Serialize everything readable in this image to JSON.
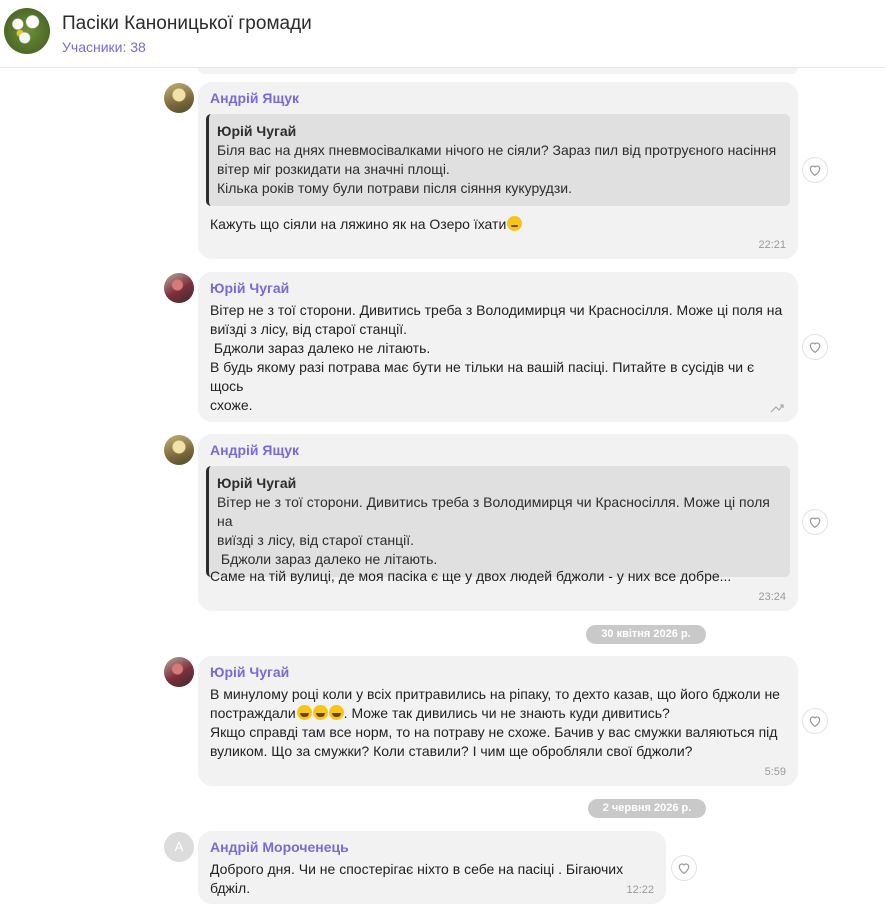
{
  "header": {
    "title": "Пасіки Каноницької громади",
    "members": "Учасники: 38"
  },
  "messages": [
    {
      "sender": "Андрій Ящук",
      "avatar": "andrii-yashchuk-avatar",
      "quote": {
        "author": "Юрій Чугай",
        "lines": [
          "Біля вас на днях пневмосівалками нічого не сіяли? Зараз пил від протруєного насіння",
          "вітер міг розкидати на значні площі.",
          "Кілька років тому були потрави після сіяння кукурудзи."
        ]
      },
      "text_lines": [
        "Кажуть що сіяли на ляжино як на Озеро їхати"
      ],
      "time": "22:21"
    },
    {
      "sender": "Юрій Чугай",
      "avatar": "yurii-chuhai-avatar",
      "text_lines": [
        "Вітер не з тої сторони. Дивитись треба з Володимирця чи Красносілля. Може ці поля на",
        "виїзді з лісу, від старої станції.",
        " Бджоли зараз далеко не літають.",
        "В будь якому разі потрава має бути не тільки на вашій пасіці. Питайте в сусідів чи є щось",
        "схоже."
      ]
    },
    {
      "sender": "Андрій Ящук",
      "avatar": "andrii-yashchuk-avatar",
      "quote": {
        "author": "Юрій Чугай",
        "lines": [
          "Вітер не з тої сторони. Дивитись треба з Володимирця чи Красносілля. Може ці поля на",
          "виїзді з лісу, від старої станції.",
          " Бджоли зараз далеко не літають."
        ]
      },
      "text_lines": [
        "Саме на тій вулиці, де моя пасіка є ще у двох людей бджоли - у них все добре..."
      ],
      "time": "23:24"
    },
    {
      "sender": "Юрій Чугай",
      "avatar": "yurii-chuhai-avatar",
      "text_lines": [
        "В минулому році коли у всіх притравились на ріпаку, то дехто казав, що його бджоли не",
        "постраждали",
        ". Може так дивились чи не знають куди дивитись?",
        "Якщо справді там все норм, то на потраву не схоже. Бачив у вас смужки валяються під",
        "вуликом.  Що за смужки? Коли ставили? І чим ще обробляли свої бджоли?"
      ],
      "time": "5:59"
    },
    {
      "sender": "Андрій Мороченець",
      "avatar_letter": "A",
      "text_lines": [
        "Доброго дня. Чи не спостерігає ніхто в себе на пасіці . Бігаючих бджіл."
      ],
      "time": "12:22"
    }
  ],
  "dates": [
    "30 квітня 2026 р.",
    "2 червня 2026 р."
  ],
  "icons": {
    "like": "heart-icon",
    "forward": "forward-icon"
  },
  "colors": {
    "accent": "#7b6ad6",
    "bubble": "#f2f2f2",
    "quote": "#e0e0e0"
  }
}
